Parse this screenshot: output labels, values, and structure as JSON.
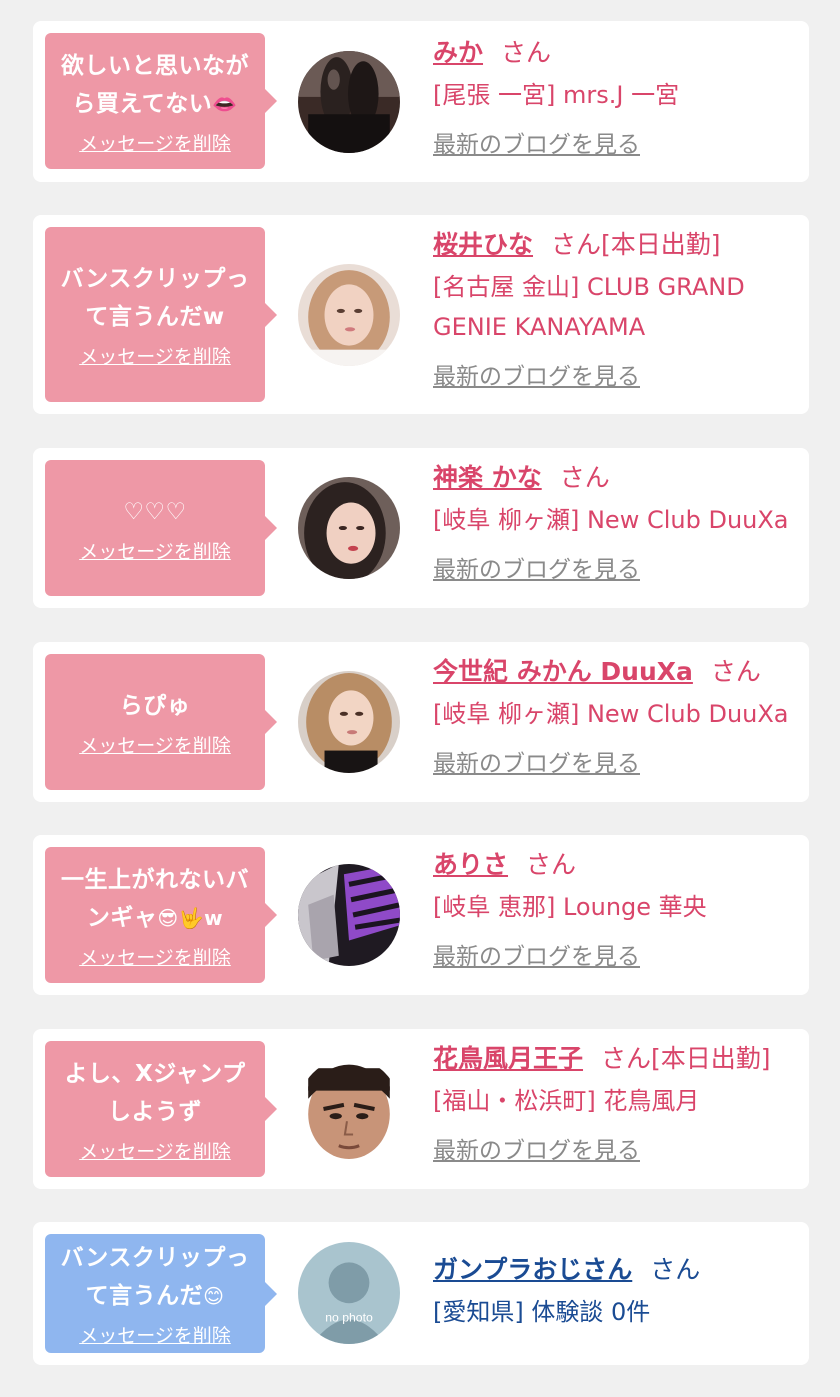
{
  "cards": [
    {
      "message": "欲しいと思いながら買えてない",
      "message_emoji": "👄",
      "delete_label": "メッセージを削除",
      "name": "みか",
      "suffix": "さん",
      "shop": "[尾張 一宮] mrs.J 一宮",
      "blog_label": "最新のブログを見る",
      "avatar_icon": "photo-legs-icon"
    },
    {
      "message": "バンスクリップって言うんだw",
      "message_emoji": "",
      "delete_label": "メッセージを削除",
      "name": "桜井ひな",
      "suffix": "さん[本日出勤]",
      "shop": "[名古屋 金山] CLUB GRAND GENIE KANAYAMA",
      "blog_label": "最新のブログを見る",
      "avatar_icon": "photo-woman-icon"
    },
    {
      "message": "♡♡♡",
      "message_emoji": "",
      "delete_label": "メッセージを削除",
      "name": "神楽 かな",
      "suffix": "さん",
      "shop": "[岐阜 柳ヶ瀬] New Club DuuXa",
      "blog_label": "最新のブログを見る",
      "avatar_icon": "photo-woman-icon"
    },
    {
      "message": "らぴゅ",
      "message_emoji": "",
      "delete_label": "メッセージを削除",
      "name": "今世紀 みかん DuuXa",
      "suffix": "さん",
      "shop": "[岐阜 柳ヶ瀬] New Club DuuXa",
      "blog_label": "最新のブログを見る",
      "avatar_icon": "photo-woman-icon"
    },
    {
      "message": "一生上がれないバンギャ",
      "message_emoji": "😎🤟w",
      "delete_label": "メッセージを削除",
      "name": "ありさ",
      "suffix": "さん",
      "shop": "[岐阜 恵那] Lounge 華央",
      "blog_label": "最新のブログを見る",
      "avatar_icon": "photo-zebra-icon"
    },
    {
      "message": "よし、Xジャンプしようず",
      "message_emoji": "",
      "delete_label": "メッセージを削除",
      "name": "花鳥風月王子",
      "suffix": "さん[本日出勤]",
      "shop": "[福山・松浜町] 花鳥風月",
      "blog_label": "最新のブログを見る",
      "avatar_icon": "photo-man-icon"
    },
    {
      "message": "バンスクリップって言うんだ",
      "message_emoji": "😊",
      "delete_label": "メッセージを削除",
      "name": "ガンプラおじさん",
      "suffix": "さん",
      "shop": "[愛知県] 体験談 0件",
      "blog_label": "",
      "avatar_icon": "no-photo-icon",
      "avatar_text": "no photo"
    }
  ],
  "colors": {
    "pink_bubble": "#ee98a6",
    "blue_bubble": "#8fb6ef",
    "name_red": "#d9456a",
    "name_navy": "#1a4b93",
    "link_gray": "#8a8a8a",
    "background": "#f0f0f0"
  }
}
